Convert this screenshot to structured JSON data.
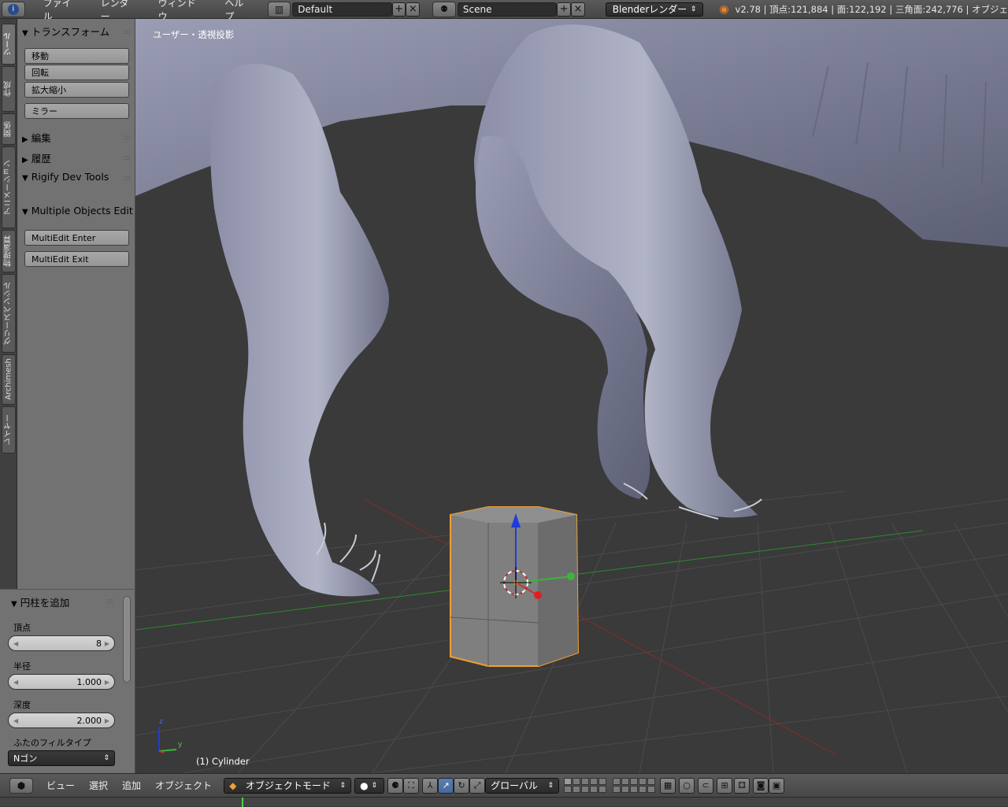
{
  "topbar": {
    "menus": [
      "ファイル",
      "レンダー",
      "ウィンドウ",
      "ヘルプ"
    ],
    "layout_name": "Default",
    "scene_name": "Scene",
    "renderer": "Blenderレンダー",
    "stats": "v2.78 | 頂点:121,884 | 面:122,192 | 三角面:242,776 | オブジェ"
  },
  "left_tabs": [
    "ツール",
    "作成",
    "関係",
    "アニメーション",
    "物理演算",
    "グリースペンシル",
    "Archimesh",
    "レイヤー"
  ],
  "tool_shelf": {
    "transform_header": "トランスフォーム",
    "move": "移動",
    "rotate": "回転",
    "scale": "拡大縮小",
    "mirror": "ミラー",
    "edit_header": "編集",
    "history_header": "履歴",
    "rigify_header": "Rigify Dev Tools",
    "multi_header": "Multiple Objects Edit",
    "multi_enter": "MultiEdit Enter",
    "multi_exit": "MultiEdit Exit"
  },
  "operator": {
    "header": "円柱を追加",
    "vertices_label": "頂点",
    "vertices_value": "8",
    "radius_label": "半径",
    "radius_value": "1.000",
    "depth_label": "深度",
    "depth_value": "2.000",
    "fill_label": "ふたのフィルタイプ",
    "fill_value": "Nゴン"
  },
  "viewport": {
    "view_label": "ユーザー・透視投影",
    "object_label": "(1) Cylinder",
    "axis_z": "z",
    "axis_y": "y"
  },
  "bottombar": {
    "menus": [
      "ビュー",
      "選択",
      "追加",
      "オブジェクト"
    ],
    "mode": "オブジェクトモード",
    "orientation": "グローバル"
  },
  "colors": {
    "selection_outline": "#f0a030",
    "x_axis": "#c83232",
    "y_axis": "#3cb43c",
    "z_axis": "#1e3cdc",
    "mesh": "#7f7f7f",
    "creature": "#7a7d92"
  }
}
